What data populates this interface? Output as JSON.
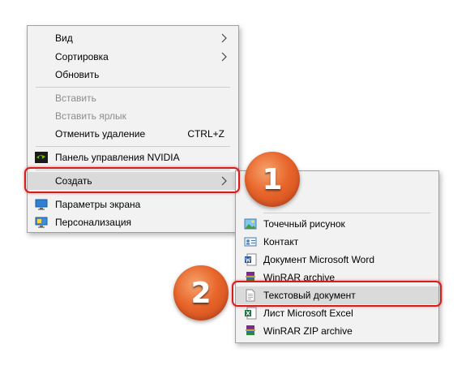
{
  "main_menu": {
    "items": [
      {
        "label": "Вид",
        "submenu": true
      },
      {
        "label": "Сортировка",
        "submenu": true
      },
      {
        "label": "Обновить"
      },
      {
        "label": "Вставить",
        "disabled": true
      },
      {
        "label": "Вставить ярлык",
        "disabled": true
      },
      {
        "label": "Отменить удаление",
        "shortcut": "CTRL+Z"
      },
      {
        "label": "Панель управления NVIDIA",
        "icon": "nvidia-icon"
      },
      {
        "label": "Создать",
        "submenu": true,
        "highlighted": true
      },
      {
        "label": "Параметры экрана",
        "icon": "display-settings-icon"
      },
      {
        "label": "Персонализация",
        "icon": "personalization-icon"
      }
    ]
  },
  "submenu": {
    "items": [
      {
        "label": "Точечный рисунок",
        "icon": "bitmap-image-icon"
      },
      {
        "label": "Контакт",
        "icon": "contact-icon"
      },
      {
        "label": "Документ Microsoft Word",
        "icon": "word-document-icon"
      },
      {
        "label": "WinRAR archive",
        "icon": "winrar-archive-icon"
      },
      {
        "label": "Текстовый документ",
        "icon": "text-document-icon",
        "highlighted": true
      },
      {
        "label": "Лист Microsoft Excel",
        "icon": "excel-sheet-icon"
      },
      {
        "label": "WinRAR ZIP archive",
        "icon": "winrar-zip-icon"
      }
    ]
  },
  "badges": {
    "step1": "1",
    "step2": "2"
  },
  "colors": {
    "highlight_outline": "#d41e1e",
    "badge_orange": "#e8662b",
    "menu_bg": "#f2f2f2"
  }
}
